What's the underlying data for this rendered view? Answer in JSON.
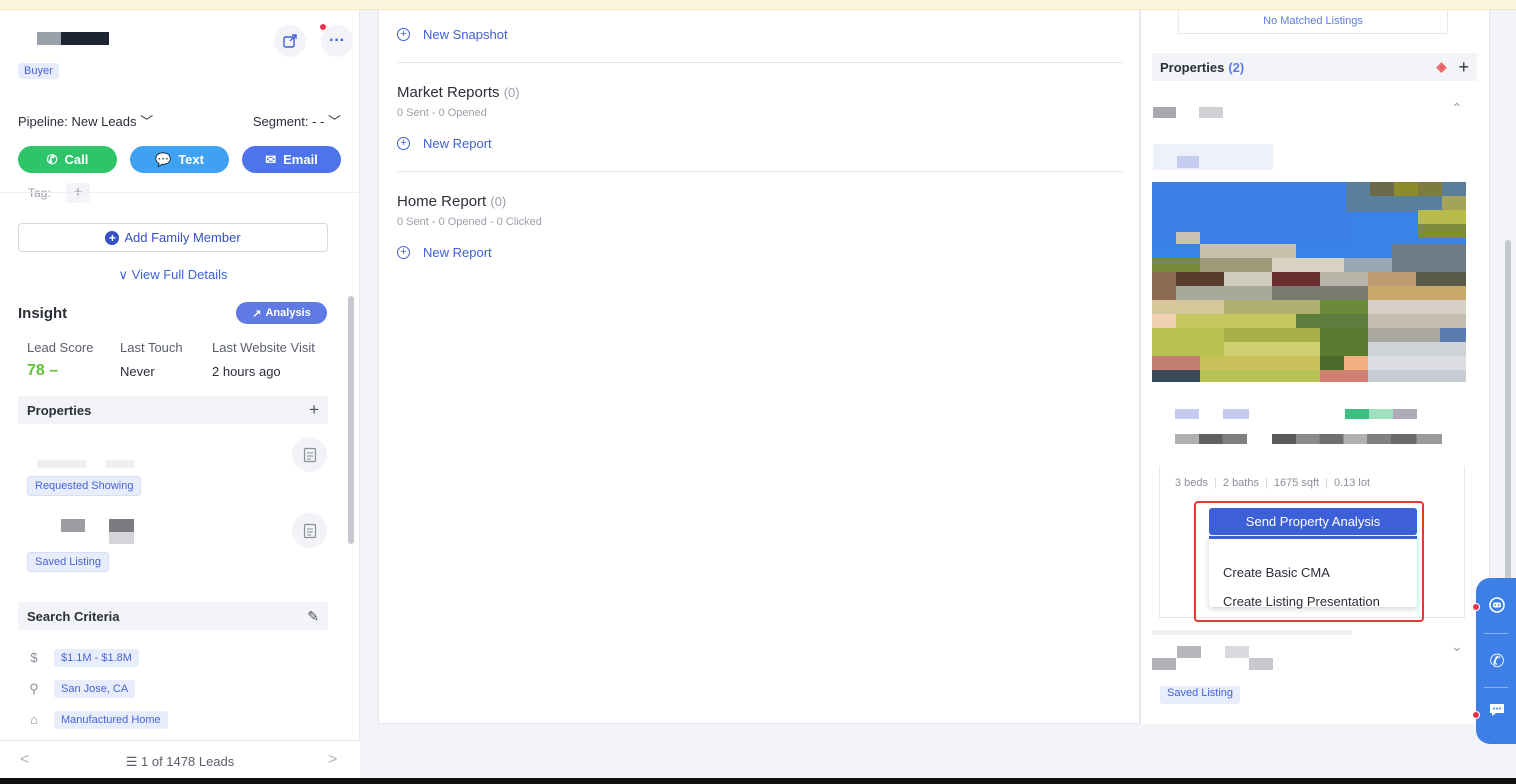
{
  "lead": {
    "tag": "Buyer",
    "pipeline_label": "Pipeline: New Leads",
    "segment_label": "Segment: - -"
  },
  "actions": {
    "call": "Call",
    "text": "Text",
    "email": "Email"
  },
  "tag_label": "Tag:",
  "add_family": "Add Family Member",
  "view_full": "View Full Details",
  "insight": {
    "title": "Insight",
    "analysis": "Analysis",
    "lead_score_label": "Lead Score",
    "lead_score_value": "78",
    "last_touch_label": "Last Touch",
    "last_touch_value": "Never",
    "last_visit_label": "Last Website Visit",
    "last_visit_value": "2 hours ago"
  },
  "properties": {
    "title": "Properties",
    "chip1": "Requested Showing",
    "chip2": "Saved Listing"
  },
  "search_criteria": {
    "title": "Search Criteria",
    "price": "$1.1M - $1.8M",
    "location": "San Jose, CA",
    "type": "Manufactured Home"
  },
  "pager": {
    "count": "1 of 1478 Leads"
  },
  "middle": {
    "new_snapshot": "New Snapshot",
    "market_reports_title": "Market Reports",
    "market_reports_count": "(0)",
    "market_reports_sub": "0 Sent - 0 Opened",
    "new_report_1": "New Report",
    "home_report_title": "Home Report",
    "home_report_count": "(0)",
    "home_report_sub": "0 Sent - 0 Opened - 0 Clicked",
    "new_report_2": "New Report"
  },
  "right": {
    "no_matched": "No Matched Listings",
    "properties_title": "Properties",
    "properties_count": "(2)",
    "beds": "3 beds",
    "baths": "2 baths",
    "sqft": "1675 sqft",
    "lot": "0.13 lot",
    "send_analysis": "Send Property Analysis",
    "menu": [
      "Create Basic CMA",
      "Create Listing Presentation"
    ],
    "saved_listing": "Saved Listing"
  },
  "colors": {
    "accent": "#3d60d9",
    "call": "#2dc46a",
    "text": "#3fa1f2",
    "email": "#4d74ea",
    "highlight": "#e23b2b"
  }
}
